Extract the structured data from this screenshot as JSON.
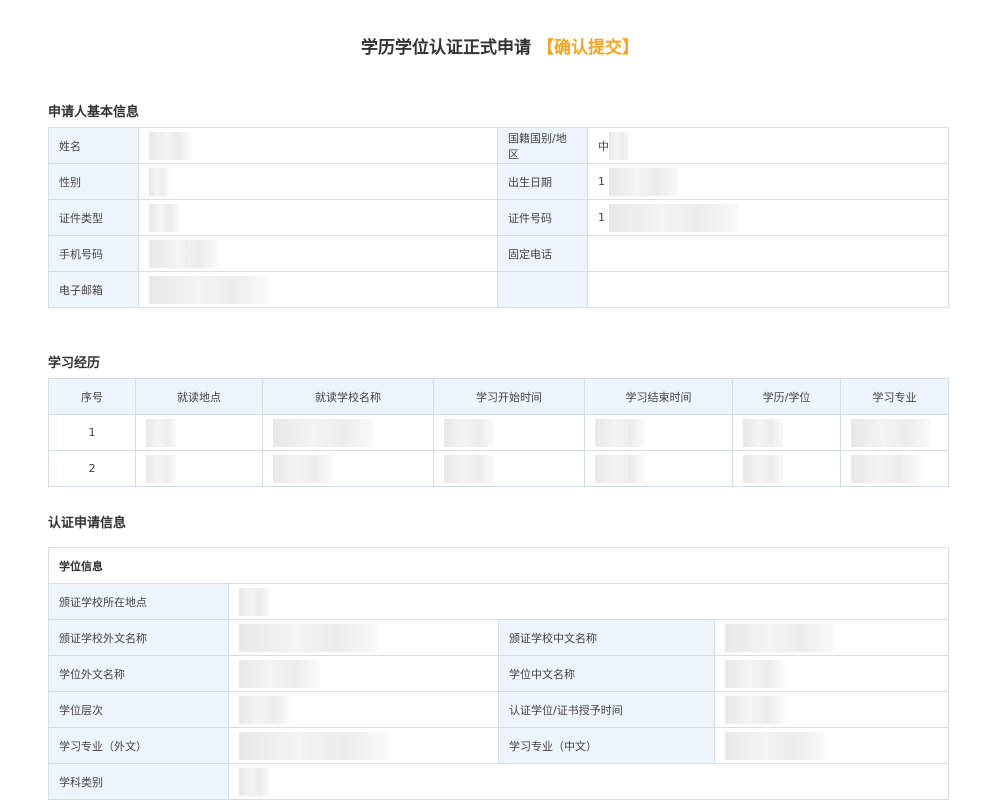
{
  "page": {
    "title": "学历学位认证正式申请",
    "title_accent": "【确认提交】"
  },
  "basic_info": {
    "heading": "申请人基本信息",
    "rows": [
      {
        "left_label": "姓名",
        "right_label": "国籍国别/地区",
        "right_value": "中"
      },
      {
        "left_label": "性别",
        "right_label": "出生日期",
        "right_value": "1"
      },
      {
        "left_label": "证件类型",
        "right_label": "证件号码",
        "right_value": "1"
      },
      {
        "left_label": "手机号码",
        "right_label": "固定电话",
        "right_value": ""
      },
      {
        "left_label": "电子邮箱",
        "right_label": "",
        "right_value": ""
      }
    ]
  },
  "study": {
    "heading": "学习经历",
    "columns": [
      "序号",
      "就读地点",
      "就读学校名称",
      "学习开始时间",
      "学习结束时间",
      "学历/学位",
      "学习专业"
    ],
    "rows": [
      {
        "index": "1"
      },
      {
        "index": "2"
      }
    ]
  },
  "cert": {
    "heading": "认证申请信息",
    "group_title": "学位信息",
    "full_rows": [
      {
        "label": "颁证学校所在地点"
      }
    ],
    "pair_rows": [
      {
        "left_label": "颁证学校外文名称",
        "right_label": "颁证学校中文名称"
      },
      {
        "left_label": "学位外文名称",
        "right_label": "学位中文名称"
      },
      {
        "left_label": "学位层次",
        "right_label": "认证学位/证书授予时间"
      },
      {
        "left_label": "学习专业（外文）",
        "right_label": "学习专业（中文）"
      }
    ],
    "last_row": {
      "label": "学科类别"
    }
  },
  "colors": {
    "accent": "#f5a623",
    "label_bg": "#eef4fc",
    "border": "#d6dde6"
  }
}
